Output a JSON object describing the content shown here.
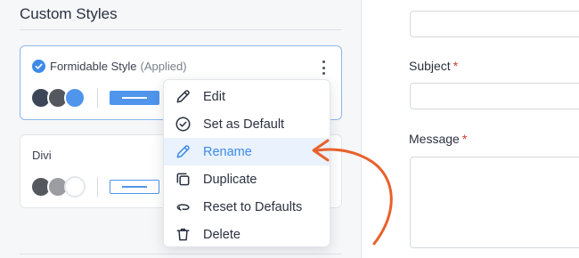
{
  "panel": {
    "title": "Custom Styles"
  },
  "styles": [
    {
      "name": "Formidable Style",
      "status": "(Applied)",
      "selected": true,
      "swatch_colors": [
        "#3d4656",
        "#54575e",
        "#4f95ec"
      ],
      "button_style": "filled"
    },
    {
      "name": "Divi",
      "status": "",
      "selected": false,
      "swatch_colors": [
        "#55585f",
        "#9b9da2",
        "#ffffff"
      ],
      "button_style": "outline"
    }
  ],
  "context_menu": {
    "items": [
      {
        "label": "Edit",
        "icon": "pencil-icon"
      },
      {
        "label": "Set as Default",
        "icon": "check-circle-icon"
      },
      {
        "label": "Rename",
        "icon": "pencil-icon",
        "highlighted": true
      },
      {
        "label": "Duplicate",
        "icon": "duplicate-icon"
      },
      {
        "label": "Reset to Defaults",
        "icon": "reset-icon"
      },
      {
        "label": "Delete",
        "icon": "trash-icon"
      }
    ]
  },
  "form": {
    "subject_label": "Subject",
    "message_label": "Message",
    "required_marker": "*"
  },
  "colors": {
    "accent": "#3d8be8",
    "highlight_bg": "#eaf2fd",
    "annotation_arrow": "#e8612c",
    "required": "#d33a2c"
  }
}
